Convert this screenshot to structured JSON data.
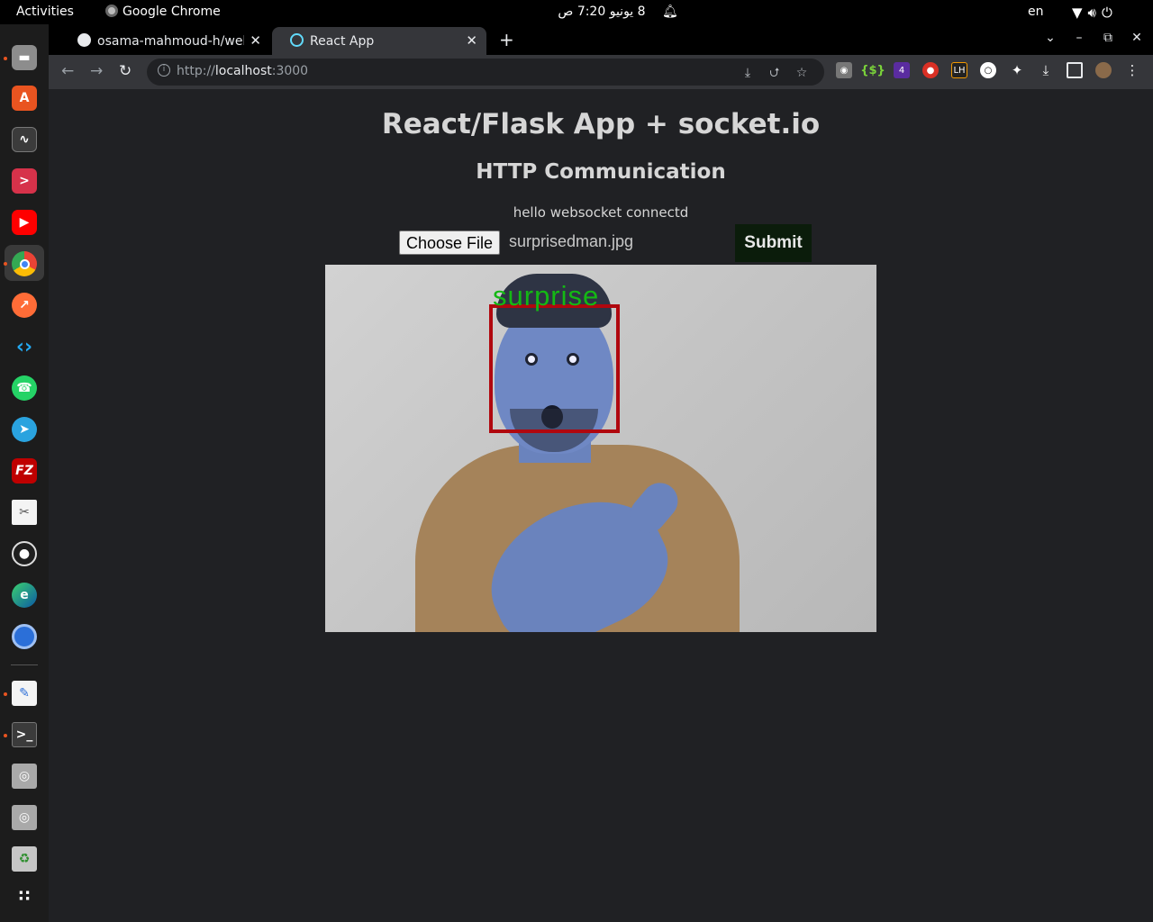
{
  "system_bar": {
    "activities": "Activities",
    "app_name": "Google Chrome",
    "clock": "8 يونيو  7:20 ص",
    "language": "en"
  },
  "browser": {
    "tabs": [
      {
        "title": "osama-mahmoud-h/webs",
        "active": false
      },
      {
        "title": "React App",
        "active": true
      }
    ],
    "url_scheme": "http://",
    "url_host": "localhost",
    "url_port": ":3000"
  },
  "page": {
    "title": "React/Flask App + socket.io",
    "subtitle": "HTTP Communication",
    "status": "hello websocket connectd",
    "file_button": "Choose File",
    "file_name": "surprisedman.jpg",
    "submit": "Submit",
    "emotion_label": "surprise",
    "box_color": "#b0070e",
    "label_color": "#14b814"
  },
  "dock": {
    "icons": [
      "files-icon",
      "app-center-icon",
      "system-monitor-icon",
      "terminal-red-icon",
      "youtube-icon",
      "chrome-icon",
      "postman-icon",
      "vscode-icon",
      "whatsapp-icon",
      "telegram-icon",
      "filezilla-icon",
      "document-icon",
      "obs-icon",
      "edge-icon",
      "chromium-icon",
      "text-editor-icon",
      "terminal-icon",
      "disk-icon",
      "disk-icon-2",
      "trash-icon",
      "app-grid-icon"
    ]
  }
}
